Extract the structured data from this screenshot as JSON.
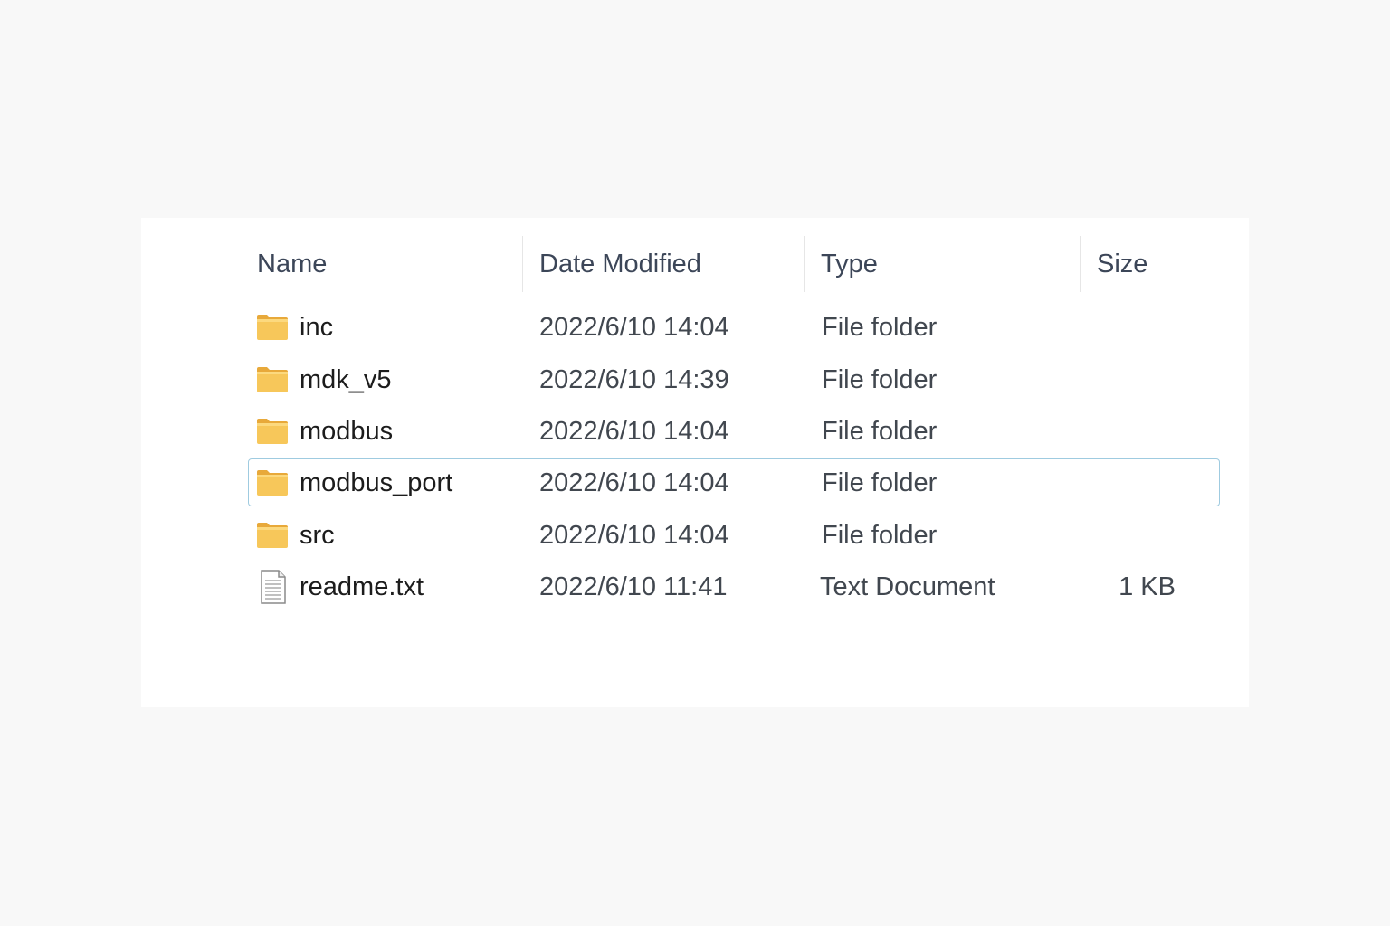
{
  "columns": {
    "name": "Name",
    "date_modified": "Date Modified",
    "type": "Type",
    "size": "Size"
  },
  "files": [
    {
      "name": "inc",
      "date": "2022/6/10 14:04",
      "type": "File folder",
      "size": "",
      "icon": "folder-icon"
    },
    {
      "name": "mdk_v5",
      "date": "2022/6/10 14:39",
      "type": "File folder",
      "size": "",
      "icon": "folder-icon"
    },
    {
      "name": "modbus",
      "date": "2022/6/10 14:04",
      "type": "File folder",
      "size": "",
      "icon": "folder-icon"
    },
    {
      "name": "modbus_port",
      "date": "2022/6/10 14:04",
      "type": "File folder",
      "size": "",
      "icon": "folder-icon",
      "selected": true
    },
    {
      "name": "src",
      "date": "2022/6/10 14:04",
      "type": "File folder",
      "size": "",
      "icon": "folder-icon"
    },
    {
      "name": "readme.txt",
      "date": "2022/6/10 11:41",
      "type": "Text Document",
      "size": "1 KB",
      "icon": "text-document-icon"
    }
  ],
  "colors": {
    "selection_border": "#9fcbe0",
    "folder": "#f7c75a"
  }
}
